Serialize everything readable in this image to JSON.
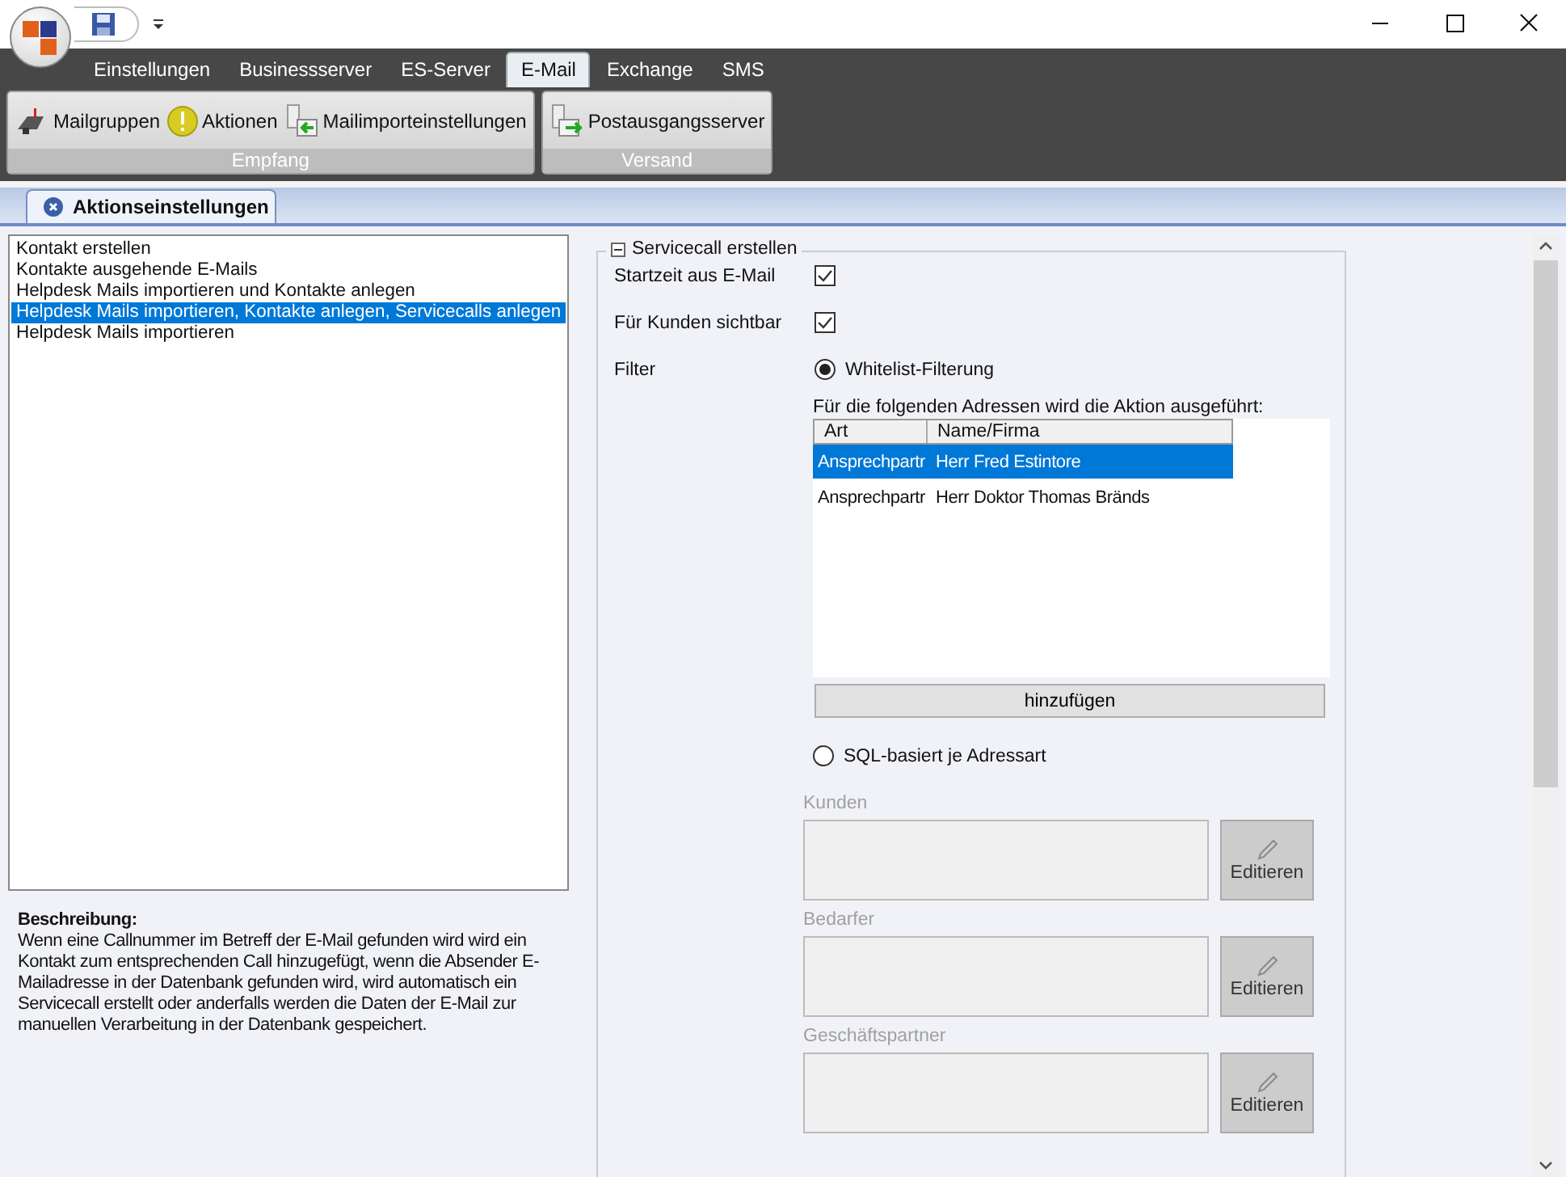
{
  "ribbon": {
    "tabs": [
      {
        "label": "Einstellungen",
        "selected": false
      },
      {
        "label": "Businessserver",
        "selected": false
      },
      {
        "label": "ES-Server",
        "selected": false
      },
      {
        "label": "E-Mail",
        "selected": true
      },
      {
        "label": "Exchange",
        "selected": false
      },
      {
        "label": "SMS",
        "selected": false
      }
    ],
    "groups": [
      {
        "label": "Empfang",
        "buttons": [
          {
            "label": "Mailgruppen",
            "kind": "mailbox"
          },
          {
            "label": "Aktionen",
            "kind": "warning"
          },
          {
            "label": "Mailimporteinstellungen",
            "kind": "import"
          }
        ]
      },
      {
        "label": "Versand",
        "buttons": [
          {
            "label": "Postausgangsserver",
            "kind": "export"
          }
        ]
      }
    ]
  },
  "document_tab": {
    "label": "Aktionseinstellungen"
  },
  "actions": [
    {
      "label": "Kontakt erstellen",
      "selected": false
    },
    {
      "label": "Kontakte ausgehende E-Mails",
      "selected": false
    },
    {
      "label": "Helpdesk Mails importieren und Kontakte anlegen",
      "selected": false
    },
    {
      "label": "Helpdesk Mails importieren, Kontakte anlegen, Servicecalls anlegen",
      "selected": true
    },
    {
      "label": "Helpdesk Mails importieren",
      "selected": false
    }
  ],
  "description": {
    "heading": "Beschreibung:",
    "text": "Wenn eine Callnummer im Betreff der E-Mail gefunden wird wird ein Kontakt zum entsprechenden Call hinzugefügt, wenn die Absender E-Mailadresse in der Datenbank gefunden wird, wird automatisch ein Servicecall erstellt oder anderfalls werden die Daten der E-Mail zur manuellen Verarbeitung in der Datenbank gespeichert."
  },
  "servicecall": {
    "title": "Servicecall erstellen",
    "expanded": true,
    "checkboxes": [
      {
        "label": "Startzeit aus E-Mail",
        "checked": true
      },
      {
        "label": "Für Kunden sichtbar",
        "checked": true
      }
    ],
    "filter": {
      "label": "Filter",
      "options": [
        {
          "label": "Whitelist-Filterung",
          "selected": true
        },
        {
          "label": "SQL-basiert je Adressart",
          "selected": false
        }
      ]
    },
    "addresses": {
      "caption": "Für die folgenden Adressen wird die Aktion ausgeführt:",
      "columns": [
        "Art",
        "Name/Firma"
      ],
      "rows": [
        {
          "cells": [
            "Ansprechpartr",
            "Herr Fred Estintore"
          ],
          "selected": true
        },
        {
          "cells": [
            "Ansprechpartr",
            "Herr Doktor Thomas Bränds"
          ],
          "selected": false
        }
      ],
      "add_button": "hinzufügen"
    },
    "sql_groups": [
      {
        "label": "Kunden",
        "button": "Editieren",
        "disabled": true
      },
      {
        "label": "Bedarfer",
        "button": "Editieren",
        "disabled": true
      },
      {
        "label": "Geschäftspartner",
        "button": "Editieren",
        "disabled": true
      }
    ]
  }
}
